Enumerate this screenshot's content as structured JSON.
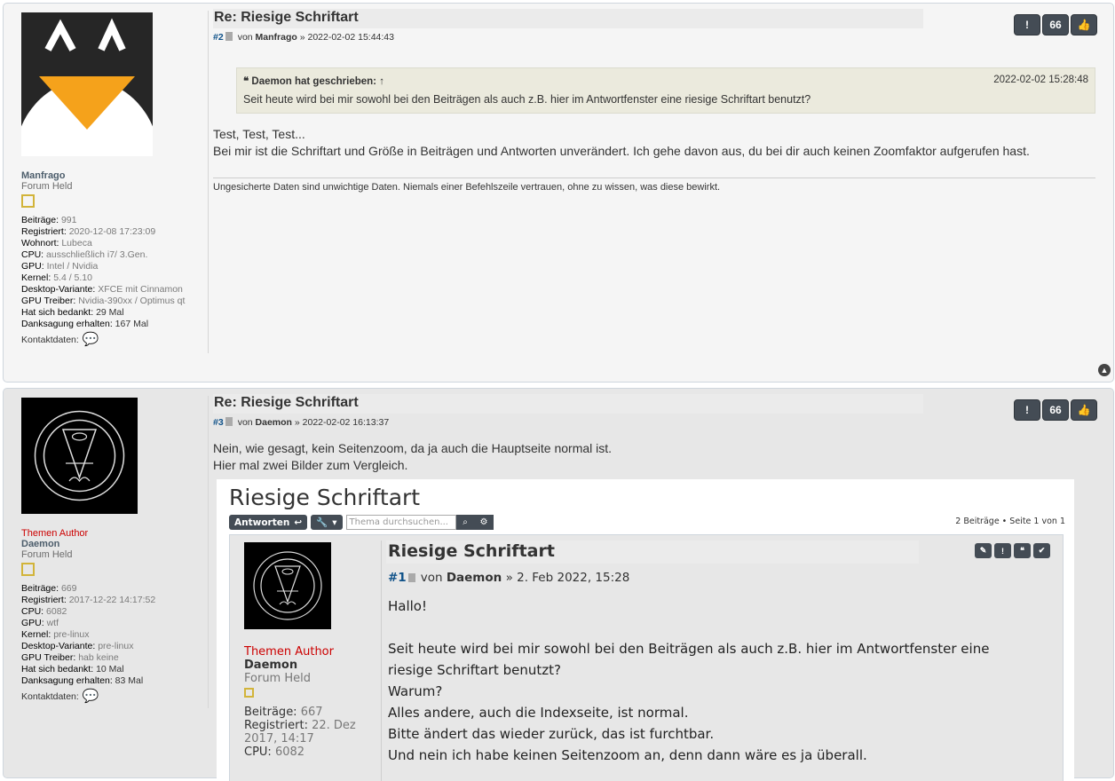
{
  "posts": [
    {
      "title": "Re: Riesige Schriftart",
      "number": "#2",
      "by": "von",
      "author": "Manfrago",
      "datetime": "» 2022-02-02 15:44:43",
      "buttons": [
        "!",
        "66",
        "👍"
      ],
      "profile": {
        "name": "Manfrago",
        "rank": "Forum Held",
        "info": [
          {
            "k": "Beiträge:",
            "v": "991"
          },
          {
            "k": "Registriert:",
            "v": "2020-12-08 17:23:09"
          },
          {
            "k": "Wohnort:",
            "v": "Lubeca"
          },
          {
            "k": "CPU:",
            "v": "ausschließlich i7/ 3.Gen."
          },
          {
            "k": "GPU:",
            "v": "Intel / Nvidia"
          },
          {
            "k": "Kernel:",
            "v": "5.4 / 5.10"
          },
          {
            "k": "Desktop-Variante:",
            "v": "XFCE mit Cinnamon"
          },
          {
            "k": "GPU Treiber:",
            "v": "Nvidia-390xx / Optimus qt"
          },
          {
            "k": "Hat sich bedankt:",
            "v": "29 Mal"
          },
          {
            "k": "Danksagung erhalten:",
            "v": "167 Mal"
          }
        ],
        "contact": "Kontaktdaten:"
      },
      "quote": {
        "who": "Daemon hat geschrieben:",
        "arrow": "↑",
        "date": "2022-02-02 15:28:48",
        "text": "Seit heute wird bei mir sowohl bei den Beiträgen als auch z.B. hier im Antwortfenster eine riesige Schriftart benutzt?"
      },
      "content": [
        "Test, Test, Test...",
        "Bei mir ist die Schriftart und Größe in Beiträgen und Antworten unverändert. Ich gehe davon aus, du bei dir auch keinen Zoomfaktor aufgerufen hast."
      ],
      "signature": "Ungesicherte Daten sind unwichtige Daten. Niemals einer Befehlszeile vertrauen, ohne zu wissen, was diese bewirkt."
    },
    {
      "title": "Re: Riesige Schriftart",
      "number": "#3",
      "by": "von",
      "author": "Daemon",
      "datetime": "» 2022-02-02 16:13:37",
      "buttons": [
        "!",
        "66",
        "👍"
      ],
      "profile": {
        "rank_title": "Themen Author",
        "name": "Daemon",
        "rank": "Forum Held",
        "info": [
          {
            "k": "Beiträge:",
            "v": "669"
          },
          {
            "k": "Registriert:",
            "v": "2017-12-22 14:17:52"
          },
          {
            "k": "CPU:",
            "v": "6082"
          },
          {
            "k": "GPU:",
            "v": "wtf"
          },
          {
            "k": "Kernel:",
            "v": "pre-linux"
          },
          {
            "k": "Desktop-Variante:",
            "v": "pre-linux"
          },
          {
            "k": "GPU Treiber:",
            "v": "hab keine"
          },
          {
            "k": "Hat sich bedankt:",
            "v": "10 Mal"
          },
          {
            "k": "Danksagung erhalten:",
            "v": "83 Mal"
          }
        ],
        "contact": "Kontaktdaten:"
      },
      "content": [
        "Nein, wie gesagt, kein Seitenzoom, da ja auch die Hauptseite normal ist.",
        "Hier mal zwei Bilder zum Vergleich."
      ]
    }
  ],
  "embedded": {
    "title": "Riesige Schriftart",
    "reply_label": "Antworten",
    "search_placeholder": "Thema durchsuchen...",
    "pages": "2 Beiträge • Seite 1 von 1",
    "post_title": "Riesige Schriftart",
    "post_num": "#1",
    "post_by": "von",
    "post_author": "Daemon",
    "post_date": "» 2. Feb 2022, 15:28",
    "profile": [
      "Themen Author",
      "Daemon",
      "Forum Held"
    ],
    "profile_info": [
      {
        "k": "Beiträge:",
        "v": "667"
      },
      {
        "k": "Registriert:",
        "v": "22. Dez 2017, 14:17"
      },
      {
        "k": "CPU:",
        "v": "6082"
      }
    ],
    "content": [
      "Hallo!",
      "",
      "Seit heute wird bei mir sowohl bei den Beiträgen als auch z.B. hier im Antwortfenster eine",
      "riesige Schriftart benutzt?",
      "Warum?",
      "Alles andere, auch die Indexseite, ist normal.",
      "Bitte ändert das wieder zurück, das ist furchtbar.",
      "Und nein ich habe keinen Seitenzoom an, denn dann wäre es ja überall."
    ]
  }
}
